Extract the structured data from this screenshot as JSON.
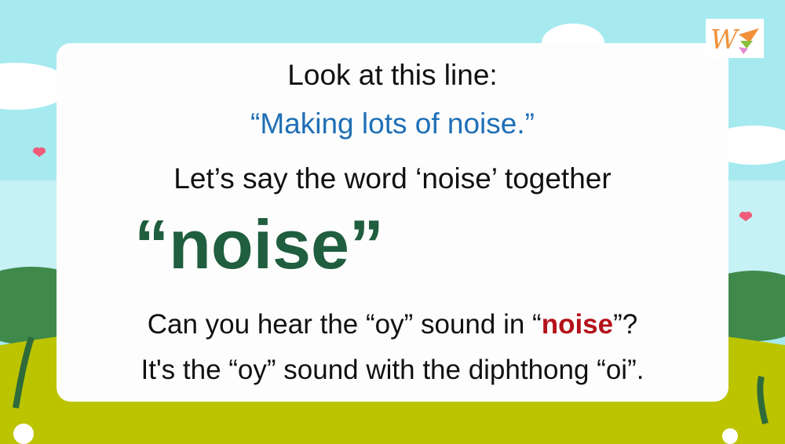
{
  "slide": {
    "line1": "Look at this line:",
    "line2": "“Making lots of noise.”",
    "line3": "Let’s say the word ‘noise’ together",
    "word": "“noise”",
    "line5_pre": "Can you hear the “oy” sound in “",
    "line5_word": "noise",
    "line5_post": "”?",
    "line6": "It's the “oy” sound with the diphthong “oi”."
  },
  "logo": {
    "text": "W"
  },
  "colors": {
    "blue": "#1f6fb5",
    "green": "#1f5e3e",
    "red": "#b3121a",
    "sky": "#a6eaf0",
    "grass": "#bcc400"
  }
}
